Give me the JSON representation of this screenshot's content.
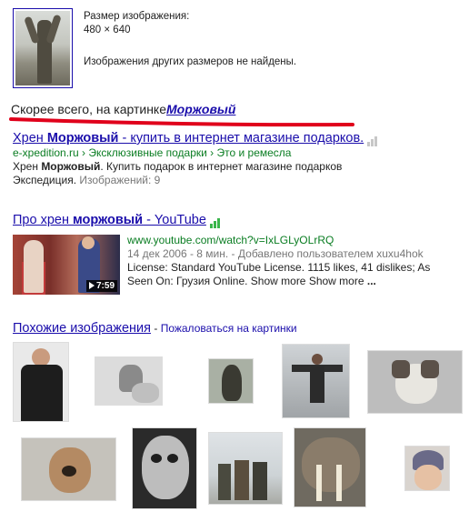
{
  "image_info": {
    "size_label": "Размер изображения:",
    "dimensions": "480 × 640",
    "no_other_sizes": "Изображения других размеров не найдены."
  },
  "best_guess": {
    "prefix": "Скорее всего, на картинке",
    "query": "Моржовый",
    "highlight_color": "#e0001b"
  },
  "results": [
    {
      "title_pre": "Хрен ",
      "title_bold": "Моржовый",
      "title_post": " - купить в интернет магазине подарков.",
      "url_domain": "e-xpedition.ru",
      "url_path": " › Эксклюзивные подарки › Это и ремесла",
      "snippet_pre": "Хрен ",
      "snippet_bold": "Моржовый",
      "snippet_post": ". Купить подарок в интернет магазине подарков",
      "snippet_line2": "Экспедиция.",
      "images_count": "Изображений: 9"
    },
    {
      "title_pre": "Про хрен ",
      "title_bold": "моржовый",
      "title_post": " - YouTube",
      "video_url": "www.youtube.com/watch?v=IxLGLyOLrRQ",
      "video_date": "14 дек 2006 - 8 мин. - Добавлено пользователем xuxu4hok",
      "video_desc1": "License: Standard YouTube License. 1115 likes, 41 dislikes; As",
      "video_desc2": "Seen On: Грузия Online. Show more Show more",
      "video_more": "...",
      "duration": "7:59"
    }
  ],
  "similar": {
    "title": "Похожие изображения",
    "separator": " - ",
    "report": "Пожаловаться на картинки"
  },
  "colors": {
    "link": "#1a0dab",
    "url_green": "#0a7d22",
    "bar_gray": "#c7c7c7",
    "bar_green": "#39b54a"
  }
}
